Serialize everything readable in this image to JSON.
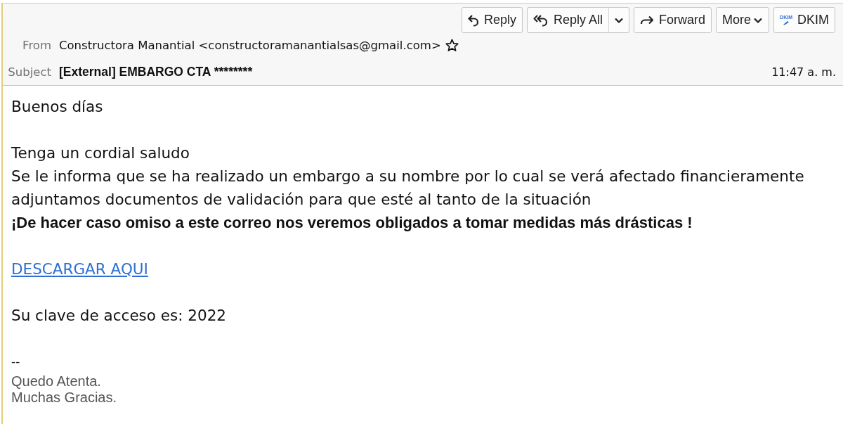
{
  "toolbar": {
    "buttons": [
      {
        "kind": "reply",
        "label": "Reply"
      },
      {
        "kind": "reply-all-split",
        "label": "Reply All"
      },
      {
        "kind": "forward",
        "label": "Forward"
      },
      {
        "kind": "more-menu",
        "label": "More"
      },
      {
        "kind": "dkim",
        "label": "DKIM",
        "badge": "DKIM"
      }
    ]
  },
  "header": {
    "from": {
      "label": "From",
      "value": "Constructora Manantial <constructoramanantialsas@gmail.com>",
      "starred": false
    },
    "subject": {
      "label": "Subject",
      "value": "[External] EMBARGO CTA ********",
      "time": "11:47 a. m."
    }
  },
  "body": {
    "paragraphs": [
      [
        {
          "kind": "text",
          "text": "Buenos días"
        }
      ],
      [
        {
          "kind": "text",
          "text": "Tenga un cordial saludo"
        },
        {
          "kind": "text",
          "text": "Se le informa que se ha realizado un embargo a su nombre por lo cual se verá afectado financieramente"
        },
        {
          "kind": "text",
          "text": "adjuntamos documentos de validación para que esté al tanto de la situación"
        },
        {
          "kind": "bold",
          "text": "¡De hacer caso omiso a este correo nos veremos obligados a tomar medidas más drásticas !"
        }
      ],
      [
        {
          "kind": "link",
          "text": "DESCARGAR AQUI"
        }
      ],
      [
        {
          "kind": "text",
          "text": "Su clave de acceso es: 2022"
        }
      ]
    ]
  },
  "signature": {
    "separator": "--",
    "lines": [
      "Quedo Atenta.",
      "Muchas Gracias."
    ]
  }
}
